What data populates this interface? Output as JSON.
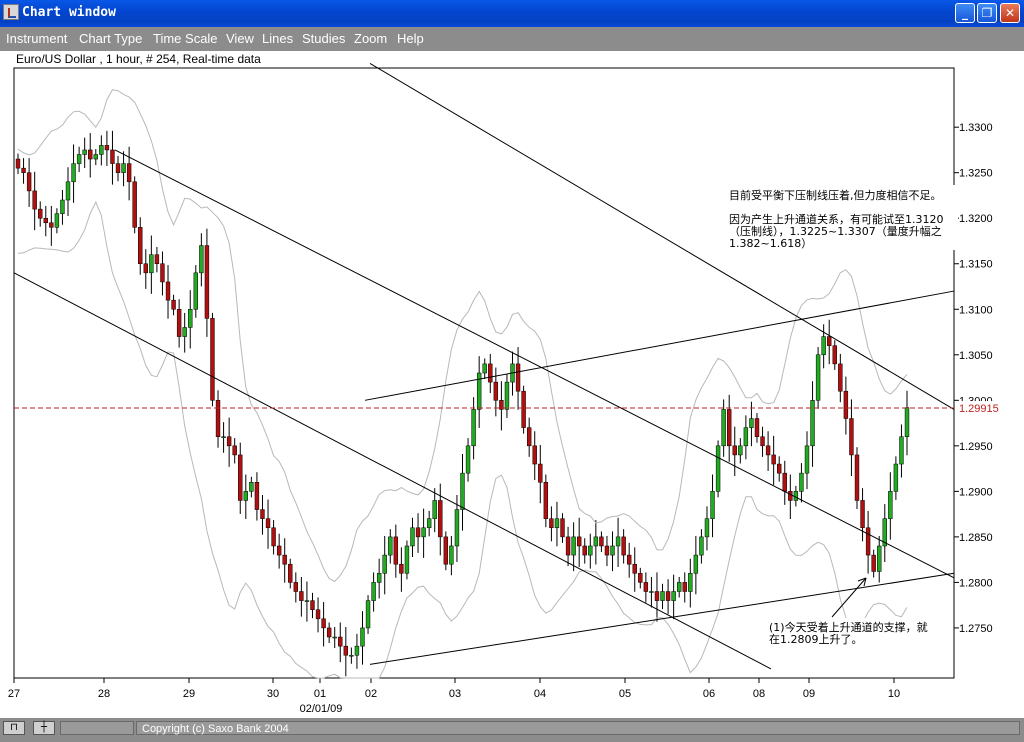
{
  "window": {
    "title": "Chart window"
  },
  "menu": [
    "Instrument",
    "Chart Type",
    "Time Scale",
    "View",
    "Lines",
    "Studies",
    "Zoom",
    "Help"
  ],
  "status": {
    "copyright": "Copyright (c) Saxo Bank 2004"
  },
  "chart_data": {
    "type": "candlestick",
    "title": "Euro/US Dollar , 1 hour, # 254, Real-time data",
    "y_ticks": [
      "1.3300",
      "1.3250",
      "1.3200",
      "1.3150",
      "1.3100",
      "1.3050",
      "1.3000",
      "1.2950",
      "1.2900",
      "1.2850",
      "1.2800",
      "1.2750"
    ],
    "ylim": [
      1.2695,
      1.3365
    ],
    "x_ticks": [
      "27",
      "28",
      "29",
      "30",
      "01",
      "02",
      "03",
      "04",
      "05",
      "06",
      "08",
      "09",
      "10"
    ],
    "x_sublabel": "02/01/09",
    "current_price": 1.29915,
    "current_price_label": "1.29915",
    "key_levels": [
      1.3307,
      1.3225,
      1.312,
      1.2809
    ],
    "closes": [
      1.3255,
      1.325,
      1.323,
      1.321,
      1.32,
      1.3195,
      1.319,
      1.3205,
      1.322,
      1.324,
      1.326,
      1.327,
      1.3275,
      1.3265,
      1.327,
      1.328,
      1.3275,
      1.326,
      1.325,
      1.326,
      1.324,
      1.319,
      1.315,
      1.314,
      1.316,
      1.315,
      1.313,
      1.311,
      1.31,
      1.307,
      1.308,
      1.31,
      1.314,
      1.317,
      1.309,
      1.3,
      1.296,
      1.296,
      1.295,
      1.294,
      1.289,
      1.29,
      1.291,
      1.288,
      1.287,
      1.286,
      1.284,
      1.283,
      1.282,
      1.28,
      1.279,
      1.278,
      1.278,
      1.277,
      1.276,
      1.275,
      1.274,
      1.274,
      1.273,
      1.272,
      1.272,
      1.273,
      1.275,
      1.278,
      1.28,
      1.281,
      1.283,
      1.285,
      1.282,
      1.281,
      1.284,
      1.286,
      1.285,
      1.286,
      1.287,
      1.289,
      1.285,
      1.282,
      1.284,
      1.288,
      1.292,
      1.295,
      1.299,
      1.303,
      1.304,
      1.302,
      1.3,
      1.299,
      1.302,
      1.304,
      1.301,
      1.297,
      1.295,
      1.293,
      1.291,
      1.287,
      1.286,
      1.287,
      1.285,
      1.283,
      1.285,
      1.284,
      1.283,
      1.284,
      1.285,
      1.284,
      1.283,
      1.284,
      1.285,
      1.283,
      1.282,
      1.281,
      1.28,
      1.279,
      1.279,
      1.278,
      1.279,
      1.278,
      1.279,
      1.28,
      1.279,
      1.281,
      1.283,
      1.285,
      1.287,
      1.29,
      1.295,
      1.299,
      1.295,
      1.294,
      1.295,
      1.297,
      1.298,
      1.296,
      1.295,
      1.294,
      1.293,
      1.292,
      1.29,
      1.289,
      1.29,
      1.292,
      1.295,
      1.3,
      1.305,
      1.307,
      1.306,
      1.304,
      1.301,
      1.298,
      1.294,
      1.289,
      1.286,
      1.283,
      1.2812,
      1.284,
      1.287,
      1.29,
      1.293,
      1.296,
      1.2992
    ]
  },
  "annotations": {
    "top": [
      "目前受平衡下压制线压着,但力度相信不足。",
      "因为产生上升通道关系，有可能试至1.3120",
      "（压制线），1.3225~1.3307（量度升幅之",
      "1.382~1.618）"
    ],
    "bottom": [
      "(1)今天受着上升通道的支撑，就",
      "在1.2809上升了。"
    ]
  }
}
